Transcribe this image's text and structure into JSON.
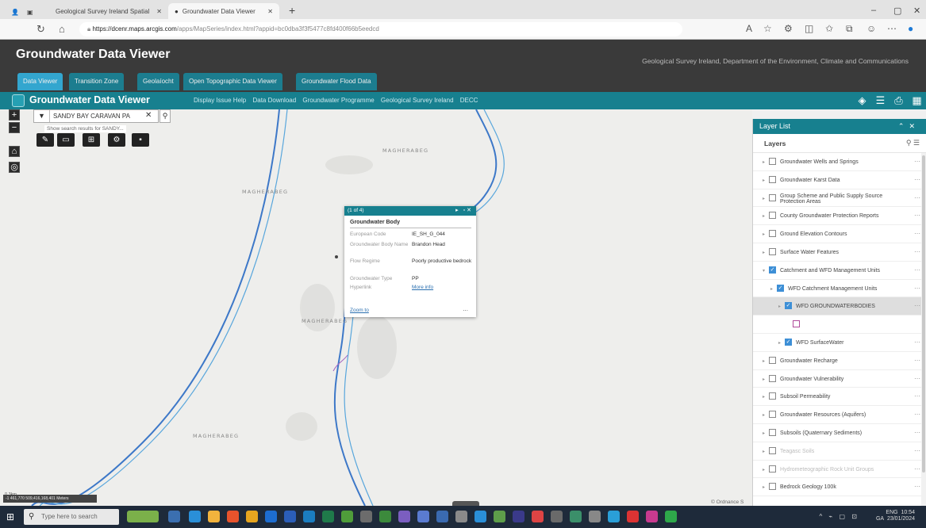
{
  "browser": {
    "tabs": [
      "Geological Survey Ireland Spatial",
      "Groundwater Data Viewer"
    ],
    "url_host": "https://dcenr.maps.arcgis.com",
    "url_path": "/apps/MapSeries/index.html?appid=bc0dba3f3f5477c8fd400f66b5eedcd"
  },
  "app": {
    "title": "Groundwater Data Viewer",
    "subtitle": "Geological Survey Ireland, Department of the Environment, Climate and Communications",
    "tabs": [
      "Data Viewer",
      "Transition Zone",
      "Geolaíocht",
      "Open Topographic Data Viewer",
      "Groundwater Flood Data"
    ]
  },
  "widget_bar": {
    "title": "Groundwater Data Viewer",
    "links": [
      "Display Issue Help",
      "Data Download",
      "Groundwater Programme",
      "Geological Survey Ireland",
      "DECC"
    ]
  },
  "map": {
    "search_value": "SANDY BAY CARAVAN PA",
    "search_hint": "Show search results for SANDY...",
    "places": [
      "MAGHERABEG",
      "MAGHERABEG",
      "MAGHERABEG",
      "MAGHERABEG"
    ],
    "scale_label": "0.3km",
    "coords": "-1 461,770 509,416,168,401 Meters",
    "attribution": "© Ordnance S"
  },
  "popup": {
    "counter": "(1 of 4)",
    "title": "Groundwater Body",
    "rows": [
      {
        "key": "European Code",
        "value": "IE_SH_G_044"
      },
      {
        "key": "Groundwater Body Name",
        "value": "Brandon Head"
      },
      {
        "key": "Flow Regime",
        "value": "Poorly productive bedrock"
      },
      {
        "key": "Groundwater Type",
        "value": "PP"
      },
      {
        "key": "Hyperlink",
        "value": "More info"
      }
    ],
    "zoom_to": "Zoom to",
    "more": "..."
  },
  "layer_list": {
    "header": "Layer List",
    "subheader": "Layers",
    "items": [
      {
        "label": "Groundwater Wells and Springs",
        "checked": false,
        "indent": 0
      },
      {
        "label": "Groundwater Karst Data",
        "checked": false,
        "indent": 0
      },
      {
        "label": "Group Scheme and Public Supply Source Protection Areas",
        "checked": false,
        "indent": 0
      },
      {
        "label": "County Groundwater Protection Reports",
        "checked": false,
        "indent": 0
      },
      {
        "label": "Ground Elevation Contours",
        "checked": false,
        "indent": 0
      },
      {
        "label": "Surface Water Features",
        "checked": false,
        "indent": 0
      },
      {
        "label": "Catchment and WFD Management Units",
        "checked": true,
        "indent": 0
      },
      {
        "label": "WFD Catchment Management Units",
        "checked": true,
        "indent": 1
      },
      {
        "label": "WFD GROUNDWATERBODIES",
        "checked": true,
        "indent": 2
      },
      {
        "label": "",
        "checked": false,
        "indent": 3
      },
      {
        "label": "WFD SurfaceWater",
        "checked": true,
        "indent": 2
      },
      {
        "label": "Groundwater Recharge",
        "checked": false,
        "indent": 0
      },
      {
        "label": "Groundwater Vulnerability",
        "checked": false,
        "indent": 0
      },
      {
        "label": "Subsoil Permeability",
        "checked": false,
        "indent": 0
      },
      {
        "label": "Groundwater Resources (Aquifers)",
        "checked": false,
        "indent": 0
      },
      {
        "label": "Subsoils (Quaternary Sediments)",
        "checked": false,
        "indent": 0
      },
      {
        "label": "Teagasc Soils",
        "checked": false,
        "indent": 0
      },
      {
        "label": "Hydrometeographic Rock Unit Groups",
        "checked": false,
        "indent": 0
      },
      {
        "label": "Bedrock Geology 100k",
        "checked": false,
        "indent": 0
      }
    ]
  },
  "taskbar": {
    "search_placeholder": "Type here to search",
    "lang": "ENG",
    "lang_sub": "GA",
    "time": "10:54",
    "date": "23/01/2024"
  }
}
